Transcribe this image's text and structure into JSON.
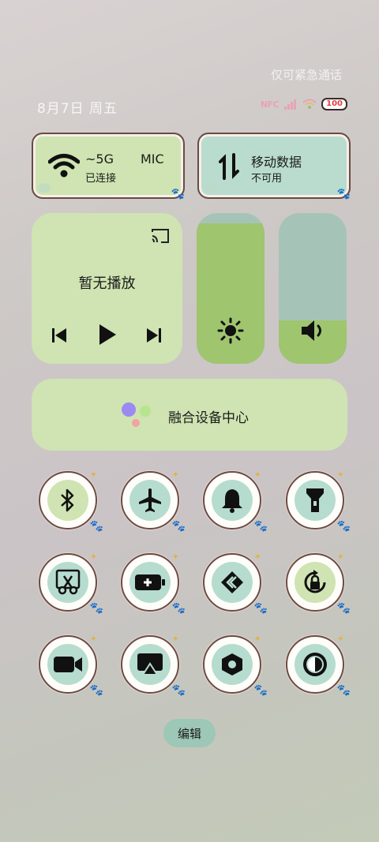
{
  "status": {
    "emergency_text": "仅可紧急通话",
    "date": "8月7日 周五",
    "nfc": "NFC",
    "battery": "100"
  },
  "tiles": {
    "wifi": {
      "title": "~5G",
      "title_extra": "MIC",
      "status": "已连接"
    },
    "mobile": {
      "title": "移动数据",
      "status": "不可用"
    }
  },
  "media": {
    "title": "暂无播放"
  },
  "fusion": {
    "title": "融合设备中心"
  },
  "sliders": {
    "brightness_level": 0.93,
    "volume_level": 0.29
  },
  "toggles": [
    {
      "name": "bluetooth",
      "icon": "bluetooth-icon",
      "active": true
    },
    {
      "name": "airplane",
      "icon": "airplane-icon",
      "active": false
    },
    {
      "name": "ring",
      "icon": "bell-icon",
      "active": false
    },
    {
      "name": "flashlight",
      "icon": "flashlight-icon",
      "active": false
    },
    {
      "name": "screenshot",
      "icon": "scissors-icon",
      "active": false
    },
    {
      "name": "power-saving",
      "icon": "battery-plus-icon",
      "active": false
    },
    {
      "name": "share",
      "icon": "share-icon",
      "active": false
    },
    {
      "name": "rotation-lock",
      "icon": "rotation-lock-icon",
      "active": true
    },
    {
      "name": "screen-record",
      "icon": "video-camera-icon",
      "active": false
    },
    {
      "name": "projection",
      "icon": "screencast-icon",
      "active": false
    },
    {
      "name": "nfc",
      "icon": "hexagon-nut-icon",
      "active": false
    },
    {
      "name": "dark-mode",
      "icon": "contrast-icon",
      "active": false
    }
  ],
  "edit": {
    "label": "编辑"
  },
  "colors": {
    "tile_green": "#cfe4b2",
    "tile_teal": "#b6dccf",
    "slider_fill": "#9fc56f",
    "slider_bg": "#a5c4b7"
  }
}
